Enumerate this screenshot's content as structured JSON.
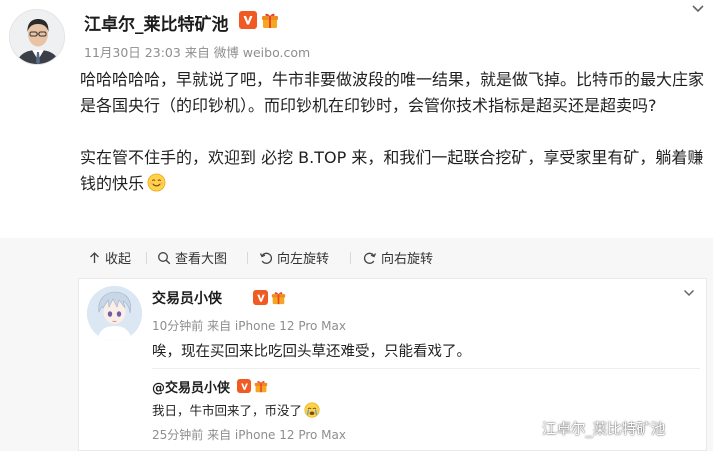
{
  "post": {
    "author": "江卓尔_莱比特矿池",
    "time": "11月30日 23:03",
    "source": "来自 微博 weibo.com",
    "paragraph1": "哈哈哈哈哈，早就说了吧，牛市非要做波段的唯一结果，就是做飞掉。比特币的最大庄家是各国央行（的印钞机）。而印钞机在印钞时，会管你技术指标是超买还是超卖吗?",
    "paragraph2": "实在管不住手的，欢迎到 必挖 B.TOP 来，和我们一起联合挖矿，享受家里有矿，躺着赚钱的快乐",
    "emoji": "smile-emoji"
  },
  "actions": {
    "collapse": "收起",
    "view_large": "查看大图",
    "rotate_left": "向左旋转",
    "rotate_right": "向右旋转"
  },
  "comment": {
    "author": "交易员小侠",
    "time": "10分钟前",
    "source": "来自 iPhone 12 Pro Max",
    "text": "唉，现在买回来比吃回头草还难受，只能看戏了。"
  },
  "reply": {
    "author": "@交易员小侠",
    "text": "我日，牛市回来了，币没了",
    "emoji": "cry-emoji",
    "time": "25分钟前",
    "source": "来自 iPhone 12 Pro Max"
  },
  "watermark": {
    "text": "江卓尔_莱比特矿池"
  },
  "colors": {
    "verified_badge": "#f05a23",
    "meta_gray": "#8e8e8e",
    "action_bar": "#f7f7f7"
  }
}
